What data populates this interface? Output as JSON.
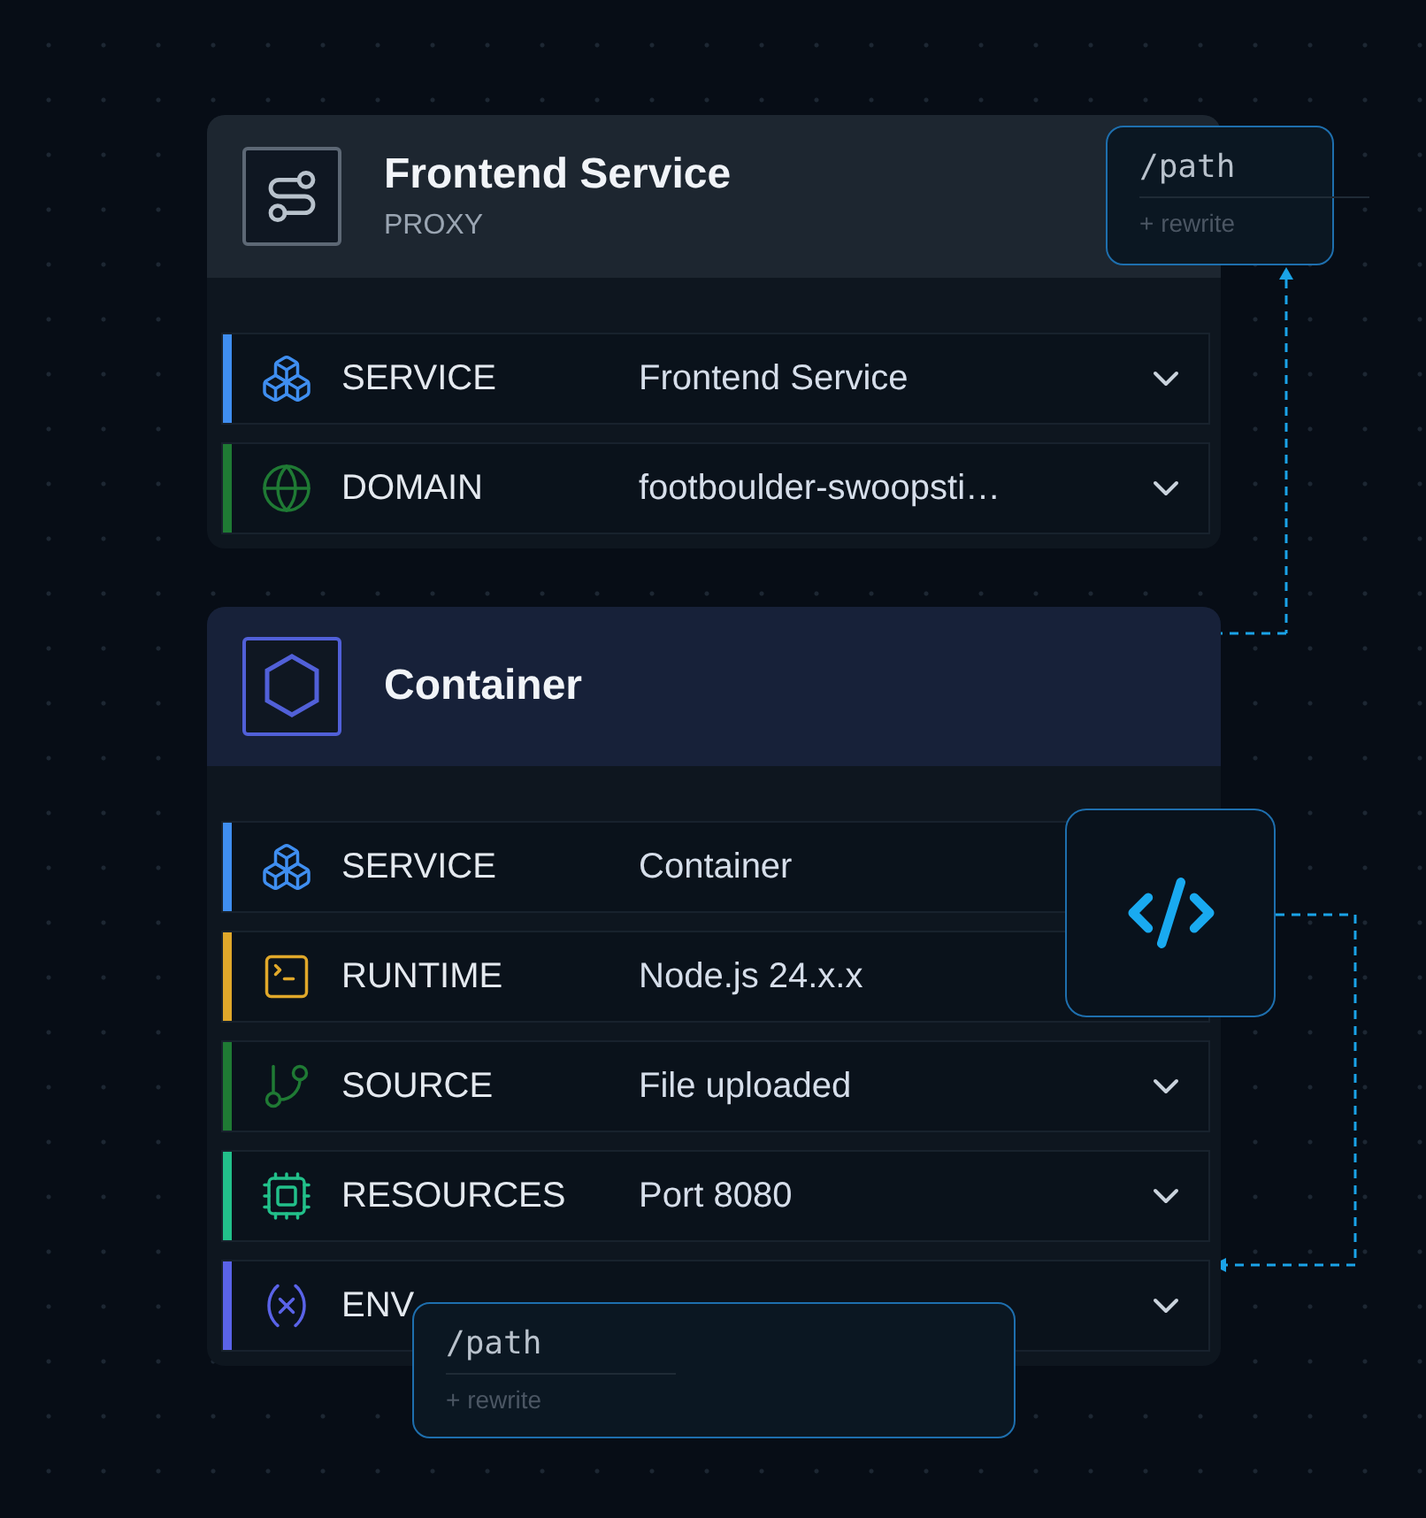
{
  "cards": [
    {
      "title": "Frontend Service",
      "subtitle": "PROXY",
      "kind": "proxy",
      "rows": [
        {
          "kind": "service",
          "color": "#3f8ef0",
          "label": "SERVICE",
          "value": "Frontend Service"
        },
        {
          "kind": "domain",
          "color": "#1f7a34",
          "label": "DOMAIN",
          "value": "footboulder-swoopsti…"
        }
      ]
    },
    {
      "title": "Container",
      "kind": "container",
      "rows": [
        {
          "kind": "service",
          "color": "#3f8ef0",
          "label": "SERVICE",
          "value": "Container"
        },
        {
          "kind": "runtime",
          "color": "#e0a82a",
          "label": "RUNTIME",
          "value": "Node.js 24.x.x"
        },
        {
          "kind": "source",
          "color": "#1f7a34",
          "label": "SOURCE",
          "value": "File uploaded"
        },
        {
          "kind": "resources",
          "color": "#22c08a",
          "label": "RESOURCES",
          "value": "Port 8080"
        },
        {
          "kind": "env",
          "color": "#5a63e8",
          "label": "ENV"
        }
      ]
    }
  ],
  "path_popups": [
    {
      "path": "/path",
      "action": "+ rewrite"
    },
    {
      "path": "/path",
      "action": "+ rewrite"
    }
  ]
}
